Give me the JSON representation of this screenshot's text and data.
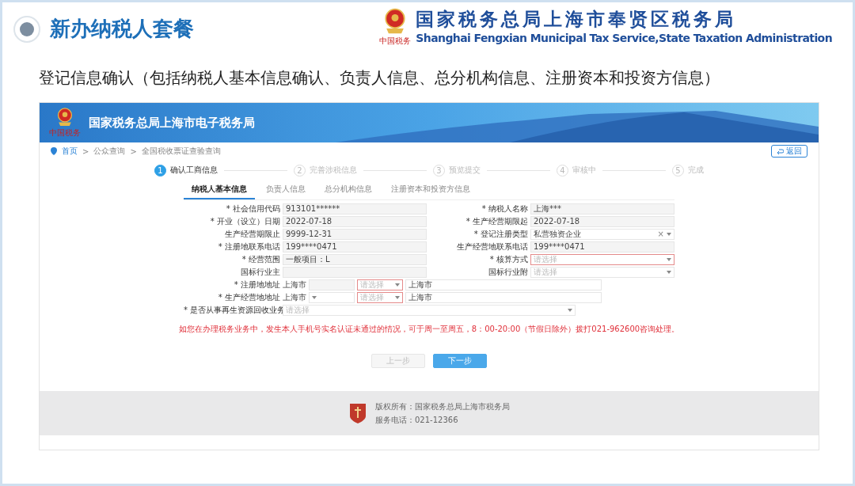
{
  "slide": {
    "title": "新办纳税人套餐",
    "org_name": "国家税务总局上海市奉贤区税务局",
    "org_name_en": "Shanghai Fengxian Municipal Tax Service,State Taxation Administration",
    "logo_script": "中国税务",
    "subtitle": "登记信息确认（包括纳税人基本信息确认、负责人信息、总分机构信息、注册资本和投资方信息）"
  },
  "site": {
    "title": "国家税务总局上海市电子税务局",
    "logo_script": "中国税务",
    "breadcrumb": [
      "首页",
      "公众查询",
      "全国税收票证查验查询"
    ],
    "separator": ">",
    "back_button": "返回",
    "steps": [
      {
        "number": "1",
        "label": "确认工商信息",
        "selected": true
      },
      {
        "number": "2",
        "label": "完善涉税信息",
        "selected": false
      },
      {
        "number": "3",
        "label": "预览提交",
        "selected": false
      },
      {
        "number": "4",
        "label": "审核中",
        "selected": false
      },
      {
        "number": "5",
        "label": "完成",
        "selected": false
      }
    ],
    "tabs": [
      {
        "label": "纳税人基本信息",
        "selected": true
      },
      {
        "label": "负责人信息",
        "selected": false
      },
      {
        "label": "总分机构信息",
        "selected": false
      },
      {
        "label": "注册资本和投资方信息",
        "selected": false
      }
    ],
    "left_fields": [
      {
        "label": "* 社会信用代码",
        "kind": "text",
        "value": "913101******"
      },
      {
        "label": "* 开业（设立）日期",
        "kind": "text",
        "value": "2022-07-18"
      },
      {
        "label": "生产经营期限止",
        "kind": "text",
        "value": "9999-12-31"
      },
      {
        "label": "* 注册地联系电话",
        "kind": "text",
        "value": "199****0471"
      },
      {
        "label": "* 经营范围",
        "kind": "text",
        "value": "一般项目：L"
      },
      {
        "label": "国标行业主",
        "kind": "text"
      }
    ],
    "right_fields": [
      {
        "label": "* 纳税人名称",
        "kind": "text",
        "value": "上海***"
      },
      {
        "label": "* 生产经营期限起",
        "kind": "text",
        "value": "2022-07-18"
      },
      {
        "label": "* 登记注册类型",
        "kind": "select",
        "value": "私营独资企业",
        "clear": "×",
        "invalid": false
      },
      {
        "label": "生产经营地联系电话",
        "kind": "text",
        "value": "199****0471"
      },
      {
        "label": "* 核算方式",
        "kind": "select",
        "placeholder": "请选择",
        "invalid": true
      },
      {
        "label": "国标行业附",
        "kind": "select",
        "placeholder": "请选择",
        "invalid": false
      }
    ],
    "address_rows": [
      {
        "label": "* 注册地地址",
        "prefix": "上海市",
        "parts": [
          {
            "kind": "text"
          },
          {
            "kind": "select",
            "placeholder": "请选择",
            "invalid": true
          },
          {
            "kind": "wide",
            "value": "上海市"
          }
        ]
      },
      {
        "label": "* 生产经营地地址",
        "prefix": "上海市",
        "parts": [
          {
            "kind": "select",
            "invalid": false
          },
          {
            "kind": "select",
            "placeholder": "请选择",
            "invalid": true
          },
          {
            "kind": "wide",
            "value": "上海市"
          }
        ]
      },
      {
        "label": "* 是否从事再生资源回收业务",
        "parts": [
          {
            "kind": "long",
            "placeholder": "请选择"
          }
        ]
      }
    ],
    "notice": "如您在办理税务业务中，发生本人手机号实名认证未通过的情况，可于周一至周五，8：00-20:00（节假日除外）拨打021-962600咨询处理。",
    "buttons": [
      {
        "label": "上一步",
        "disabled": true
      },
      {
        "label": "下一步",
        "disabled": false
      }
    ],
    "footer": {
      "copyright": "版权所有：国家税务总局上海市税务局",
      "phone": "服务电话：021-12366"
    }
  }
}
